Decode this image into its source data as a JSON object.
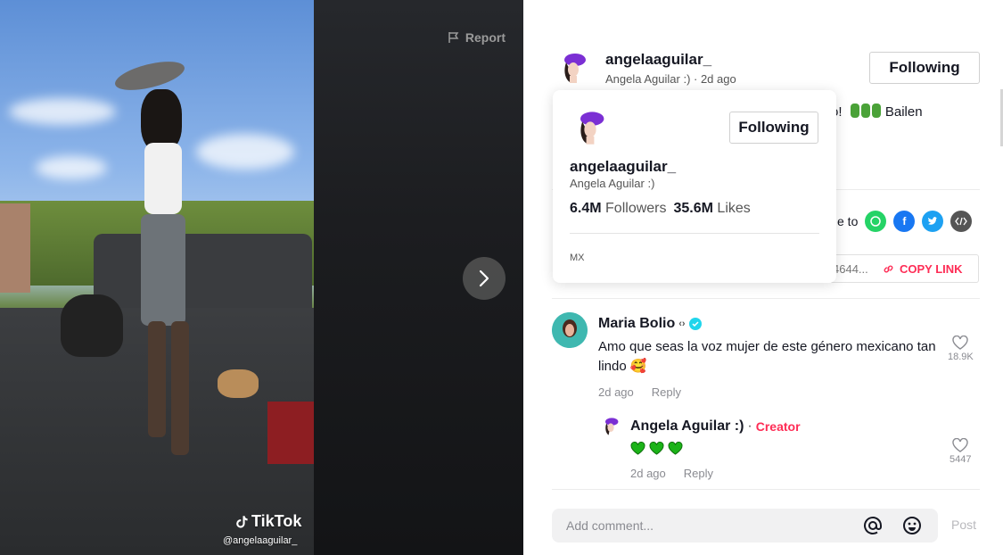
{
  "video": {
    "report_label": "Report",
    "watermark": "TikTok",
    "watermark_handle": "@angelaaguilar_"
  },
  "author": {
    "username": "angelaaguilar_",
    "subline": "Angela Aguilar :) · 2d ago",
    "follow_label": "Following"
  },
  "caption_fragment": "o!",
  "caption_tail": "Bailen",
  "share": {
    "label": "e to",
    "copy_url_fragment": "4644...",
    "copy_link_label": "COPY LINK",
    "colors": {
      "whatsapp": "#25d366",
      "facebook": "#1877f2",
      "twitter": "#1da1f2",
      "embed": "#555555"
    }
  },
  "profile_card": {
    "follow_label": "Following",
    "username": "angelaaguilar_",
    "display_name": "Angela Aguilar :)",
    "followers_count": "6.4M",
    "followers_label": "Followers",
    "likes_count": "35.6M",
    "likes_label": "Likes",
    "region": "MX"
  },
  "comments": [
    {
      "name": "Maria Bolio",
      "name_suffix": "‹›",
      "text": "Amo que seas la voz mujer de este género mexicano tan lindo 🥰",
      "time": "2d ago",
      "reply_label": "Reply",
      "likes": "18.9K"
    },
    {
      "name": "Angela Aguilar :)",
      "separator": " · ",
      "badge": "Creator",
      "time": "2d ago",
      "reply_label": "Reply",
      "likes": "5447"
    }
  ],
  "comment_bar": {
    "placeholder": "Add comment...",
    "post_label": "Post"
  },
  "theme": {
    "accent": "#fe2c55",
    "verified": "#20d5ec",
    "heart_green": "#1bb318"
  }
}
